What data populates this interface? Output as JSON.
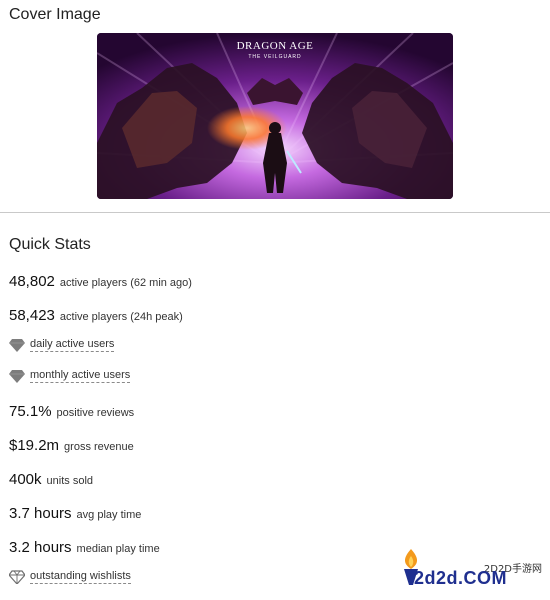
{
  "cover": {
    "section_title": "Cover Image",
    "logo_line1": "DRAGON AGE",
    "logo_line2": "THE VEILGUARD"
  },
  "stats": {
    "section_title": "Quick Stats",
    "rows": [
      {
        "value": "48,802",
        "label": "active players (62 min ago)"
      },
      {
        "value": "58,423",
        "label": "active players (24h peak)"
      },
      {
        "icon": "gem-filled-icon",
        "link": "daily active users"
      },
      {
        "icon": "gem-filled-icon",
        "link": "monthly active users"
      },
      {
        "value": "75.1%",
        "label": "positive reviews"
      },
      {
        "value": "$19.2m",
        "label": "gross revenue"
      },
      {
        "value": "400k",
        "label": "units sold"
      },
      {
        "value": "3.7 hours",
        "label": "avg play time"
      },
      {
        "value": "3.2 hours",
        "label": "median play time"
      },
      {
        "icon": "gem-outline-icon",
        "link": "outstanding wishlists"
      }
    ]
  },
  "watermark": {
    "small_text": "2D2D手游网",
    "big_text": "2d2d.COM"
  }
}
